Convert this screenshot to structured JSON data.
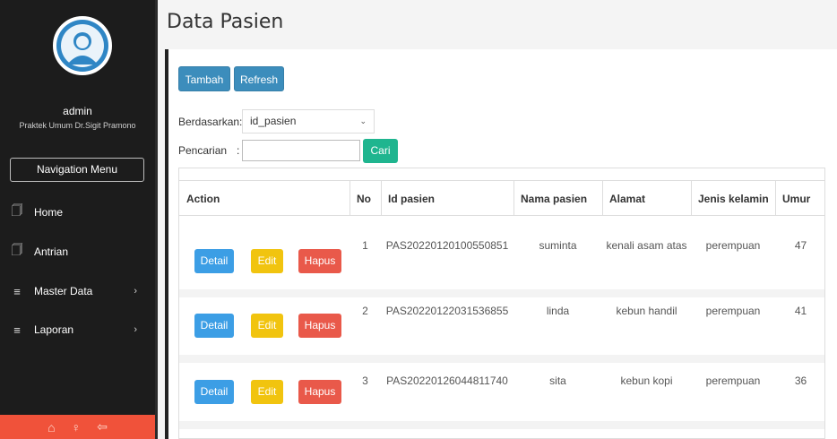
{
  "sidebar": {
    "username": "admin",
    "clinic": "Praktek Umum Dr.Sigit Pramono",
    "nav_menu_label": "Navigation Menu",
    "items": [
      {
        "label": "Home",
        "icon": "file-icon"
      },
      {
        "label": "Antrian",
        "icon": "file-icon"
      },
      {
        "label": "Master Data",
        "icon": "list-icon",
        "has_submenu": true
      },
      {
        "label": "Laporan",
        "icon": "list-icon",
        "has_submenu": true
      }
    ],
    "bottom_icons": [
      "home-icon",
      "user-icon",
      "logout-icon"
    ]
  },
  "page": {
    "title": "Data Pasien"
  },
  "toolbar": {
    "add_label": "Tambah",
    "refresh_label": "Refresh"
  },
  "filter": {
    "by_label": "Berdasarkan:",
    "by_value": "id_pasien",
    "search_label": "Pencarian",
    "search_colon": ":",
    "search_value": "",
    "search_button": "Cari"
  },
  "table": {
    "headers": [
      "Action",
      "No",
      "Id pasien",
      "Nama pasien",
      "Alamat",
      "Jenis kelamin",
      "Umur"
    ],
    "action_labels": {
      "detail": "Detail",
      "edit": "Edit",
      "hapus": "Hapus"
    },
    "rows": [
      {
        "no": "1",
        "id": "PAS20220120100550851",
        "nama": "suminta",
        "alamat": "kenali asam atas",
        "jk": "perempuan",
        "umur": "47"
      },
      {
        "no": "2",
        "id": "PAS20220122031536855",
        "nama": "linda",
        "alamat": "kebun handil",
        "jk": "perempuan",
        "umur": "41"
      },
      {
        "no": "3",
        "id": "PAS20220126044811740",
        "nama": "sita",
        "alamat": "kebun kopi",
        "jk": "perempuan",
        "umur": "36"
      }
    ]
  },
  "colors": {
    "sidebar_bg": "#1c1c1c",
    "primary": "#3c8dbc",
    "success": "#1fb58f",
    "warning": "#f1c40f",
    "danger": "#e9594a",
    "sidebar_bottom": "#f0523a"
  }
}
